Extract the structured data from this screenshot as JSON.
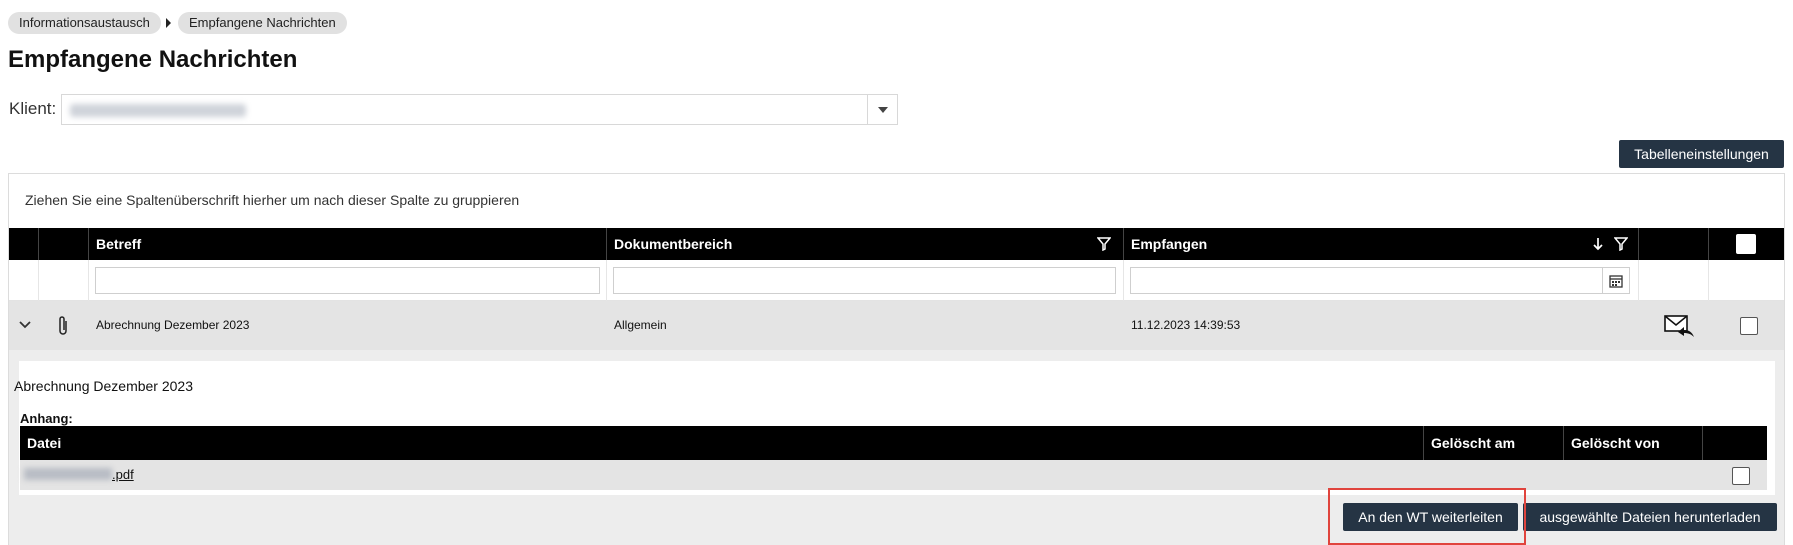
{
  "breadcrumb": {
    "items": [
      {
        "label": "Informationsaustausch"
      },
      {
        "label": "Empfangene Nachrichten"
      }
    ]
  },
  "page": {
    "title": "Empfangene Nachrichten"
  },
  "klient": {
    "label": "Klient:"
  },
  "toolbar": {
    "table_settings_label": "Tabelleneinstellungen"
  },
  "grid": {
    "group_hint": "Ziehen Sie eine Spaltenüberschrift hierher um nach dieser Spalte zu gruppieren",
    "columns": [
      {
        "label": "Betreff"
      },
      {
        "label": "Dokumentbereich"
      },
      {
        "label": "Empfangen"
      }
    ],
    "sort": {
      "column": "Empfangen",
      "direction": "descending"
    },
    "rows": [
      {
        "subject": "Abrechnung Dezember 2023",
        "area": "Allgemein",
        "received": "11.12.2023 14:39:53"
      }
    ]
  },
  "detail": {
    "subject": "Abrechnung Dezember 2023",
    "attachments_label": "Anhang:",
    "columns": [
      {
        "label": "Datei"
      },
      {
        "label": "Gelöscht am"
      },
      {
        "label": "Gelöscht von"
      }
    ],
    "files": [
      {
        "name_suffix": ".pdf"
      }
    ],
    "forward_button": "An den WT weiterleiten",
    "download_button": "ausgewählte Dateien herunterladen"
  },
  "colors": {
    "dark_button": "#253444",
    "header_bg": "#000000",
    "row_bg": "#e4e4e4",
    "highlight": "#e0443d"
  },
  "icons": {
    "expand": "chevron-down-icon",
    "attachment": "paperclip-icon",
    "reply": "mail-reply-icon",
    "filter": "funnel-icon",
    "sort": "arrow-down-icon",
    "calendar": "calendar-icon"
  }
}
